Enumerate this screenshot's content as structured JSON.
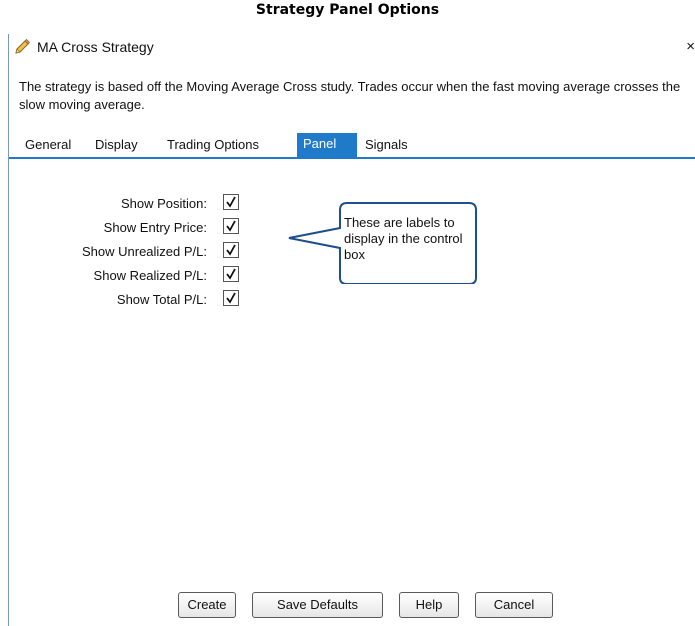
{
  "caption": "Strategy Panel Options",
  "window": {
    "title": "MA Cross Strategy",
    "close_label": "×",
    "description": "The strategy is based off the Moving Average Cross study. Trades occur when the fast moving average crosses the slow moving average."
  },
  "tabs": [
    {
      "label": "General",
      "active": false
    },
    {
      "label": "Display",
      "active": false
    },
    {
      "label": "Trading Options",
      "active": false
    },
    {
      "label": "Panel",
      "active": true
    },
    {
      "label": "Signals",
      "active": false
    }
  ],
  "options": [
    {
      "label": "Show Position:",
      "checked": true
    },
    {
      "label": "Show Entry Price:",
      "checked": true
    },
    {
      "label": "Show Unrealized P/L:",
      "checked": true
    },
    {
      "label": "Show Realized P/L:",
      "checked": true
    },
    {
      "label": "Show Total P/L:",
      "checked": true
    }
  ],
  "callout": {
    "text": "These are labels to display in the control box"
  },
  "buttons": {
    "create": "Create",
    "save_defaults": "Save Defaults",
    "help": "Help",
    "cancel": "Cancel"
  },
  "colors": {
    "accent": "#1f7ac9",
    "callout_border": "#1f4e8c"
  }
}
